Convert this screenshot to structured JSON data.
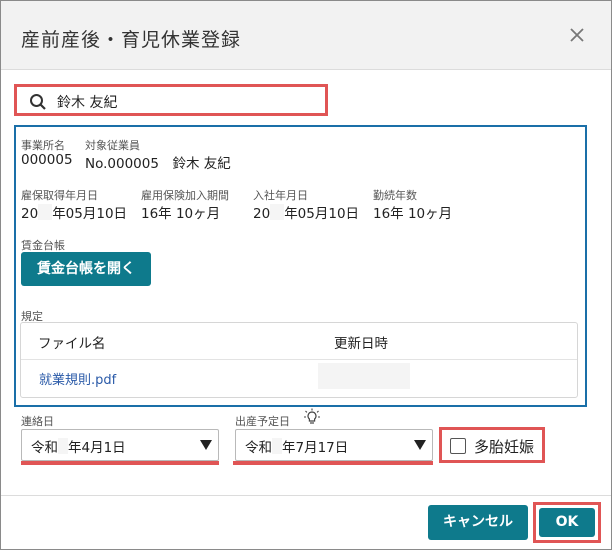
{
  "dialog": {
    "title": "産前産後・育児休業登録",
    "close_label": "×"
  },
  "search": {
    "value": "鈴木 友紀"
  },
  "employee": {
    "office_label": "事業所名",
    "office_value": "000005",
    "target_label": "対象従業員",
    "target_value": "No.000005　鈴木 友紀",
    "ins_date_label": "雇保取得年月日",
    "ins_date_prefix": "20",
    "ins_date_suffix": "年05月10日",
    "ins_period_label": "雇用保険加入期間",
    "ins_period_value": "16年 10ヶ月",
    "join_date_label": "入社年月日",
    "join_date_prefix": "20",
    "join_date_suffix": "年05月10日",
    "service_label": "勤続年数",
    "service_value": "16年 10ヶ月",
    "ledger_label": "賃金台帳",
    "ledger_button": "賃金台帳を開く"
  },
  "rules": {
    "label": "規定",
    "col_file": "ファイル名",
    "col_updated": "更新日時",
    "files": [
      {
        "name": "就業規則.pdf"
      }
    ]
  },
  "contact_date": {
    "label": "連絡日",
    "value_prefix": "令和",
    "value_suffix": "年4月1日"
  },
  "due_date": {
    "label": "出産予定日",
    "value_prefix": "令和",
    "value_suffix": "年7月17日"
  },
  "multiple_pregnancy": {
    "label": "多胎妊娠",
    "checked": false
  },
  "footer": {
    "cancel": "キャンセル",
    "ok": "OK"
  },
  "colors": {
    "accent": "#0e7a8c",
    "highlight_red": "#e05555",
    "frame_blue": "#1a6fa8",
    "link": "#2a5aa8"
  }
}
